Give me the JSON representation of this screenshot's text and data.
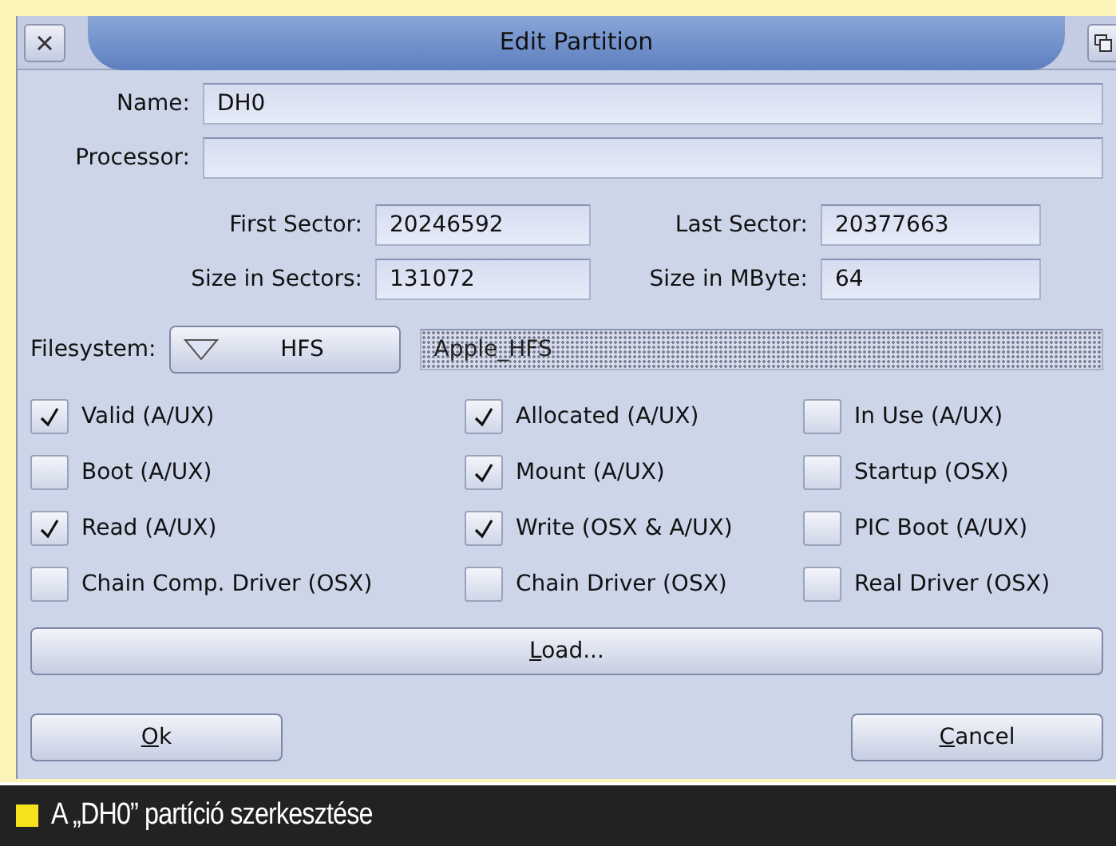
{
  "window": {
    "title": "Edit Partition"
  },
  "fields": [
    {
      "label": "Name:",
      "value": "DH0"
    },
    {
      "label": "Processor:"
    }
  ],
  "sectors": [
    {
      "label": "First Sector:",
      "value": "20246592"
    },
    {
      "label": "Last Sector:",
      "value": "20377663"
    },
    {
      "label": "Size in Sectors:",
      "value": "131072"
    },
    {
      "label": "Size in MByte:",
      "value": "64"
    }
  ],
  "filesystem": {
    "label": "Filesystem:",
    "choice": "HFS",
    "type": "Apple_HFS",
    "type_disabled": true
  },
  "flags": [
    {
      "label": "Valid (A/UX)",
      "checked": true
    },
    {
      "label": "Allocated (A/UX)",
      "checked": true
    },
    {
      "label": "In Use (A/UX)",
      "checked": false
    },
    {
      "label": "Boot (A/UX)",
      "checked": false
    },
    {
      "label": "Mount (A/UX)",
      "checked": true
    },
    {
      "label": "Startup (OSX)",
      "checked": false
    },
    {
      "label": "Read (A/UX)",
      "checked": true
    },
    {
      "label": "Write (OSX & A/UX)",
      "checked": true
    },
    {
      "label": "PIC Boot (A/UX)",
      "checked": false
    },
    {
      "label": "Chain Comp. Driver (OSX)",
      "checked": false
    },
    {
      "label": "Chain Driver (OSX)",
      "checked": false
    },
    {
      "label": "Real Driver (OSX)",
      "checked": false
    }
  ],
  "load_button": {
    "key": "L",
    "rest": "oad..."
  },
  "buttons": [
    {
      "key": "O",
      "rest": "k"
    },
    {
      "key": "C",
      "rest": "ancel"
    }
  ],
  "caption": "A „DH0” partíció szerkesztése"
}
